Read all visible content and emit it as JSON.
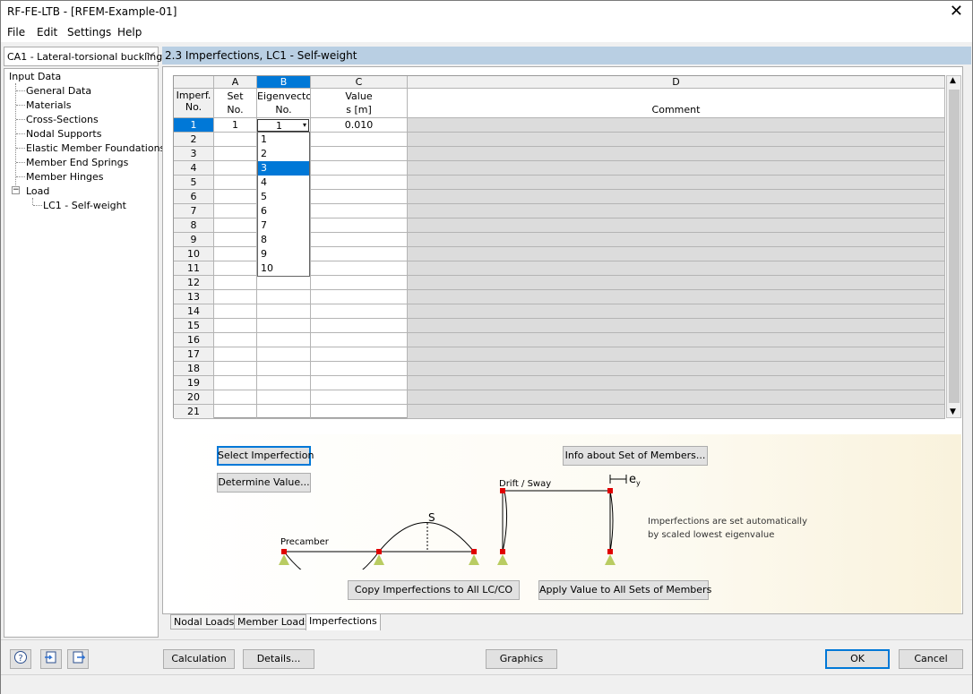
{
  "window": {
    "title": "RF-FE-LTB - [RFEM-Example-01]",
    "close": "✕"
  },
  "menu": [
    "File",
    "Edit",
    "Settings",
    "Help"
  ],
  "case_select": {
    "value": "CA1 - Lateral-torsional buckling",
    "chevron": "﹀"
  },
  "tree": {
    "root": "Input Data",
    "items": [
      "General Data",
      "Materials",
      "Cross-Sections",
      "Nodal Supports",
      "Elastic Member Foundations",
      "Member End Springs",
      "Member Hinges"
    ],
    "load": "Load",
    "load_child": "LC1 - Self-weight",
    "collapse_sign": "−"
  },
  "header": {
    "title": "2.3 Imperfections, LC1 - Self-weight"
  },
  "table": {
    "col_letters": [
      "A",
      "B",
      "C",
      "D"
    ],
    "imperf_header": "Imperf.\nNo.",
    "set_header": "Set\nNo.",
    "eig_header": "Eigenvector\nNo.",
    "value_header": "Value\ns [m]",
    "comment_header": "Comment",
    "row_numbers": [
      "1",
      "2",
      "3",
      "4",
      "5",
      "6",
      "7",
      "8",
      "9",
      "10",
      "11",
      "12",
      "13",
      "14",
      "15",
      "16",
      "17",
      "18",
      "19",
      "20",
      "21"
    ],
    "row1": {
      "set": "1",
      "eigen": "1",
      "value": "0.010"
    }
  },
  "dropdown": {
    "options": [
      "1",
      "2",
      "3",
      "4",
      "5",
      "6",
      "7",
      "8",
      "9",
      "10"
    ],
    "selected_index": 2,
    "arrow": "▾"
  },
  "buttons": {
    "select_imperfection": "Select Imperfection",
    "determine_value": "Determine Value...",
    "info_members": "Info about Set of Members...",
    "copy_imperf": "Copy Imperfections to All LC/CO",
    "apply_value": "Apply Value to All Sets of Members",
    "calculation": "Calculation",
    "details": "Details...",
    "graphics": "Graphics",
    "ok": "OK",
    "cancel": "Cancel"
  },
  "illustration": {
    "precamber": "Precamber",
    "s_label": "S",
    "drift": "Drift / Sway",
    "ey": "e",
    "ey_sub": "y",
    "note1": "Imperfections are set automatically",
    "note2": "by scaled lowest eigenvalue"
  },
  "tabs": [
    "Nodal Loads",
    "Member Loads",
    "Imperfections"
  ],
  "footer_icons": [
    "help-icon",
    "import-icon",
    "export-icon"
  ],
  "scroll": {
    "up": "▲",
    "down": "▼"
  }
}
